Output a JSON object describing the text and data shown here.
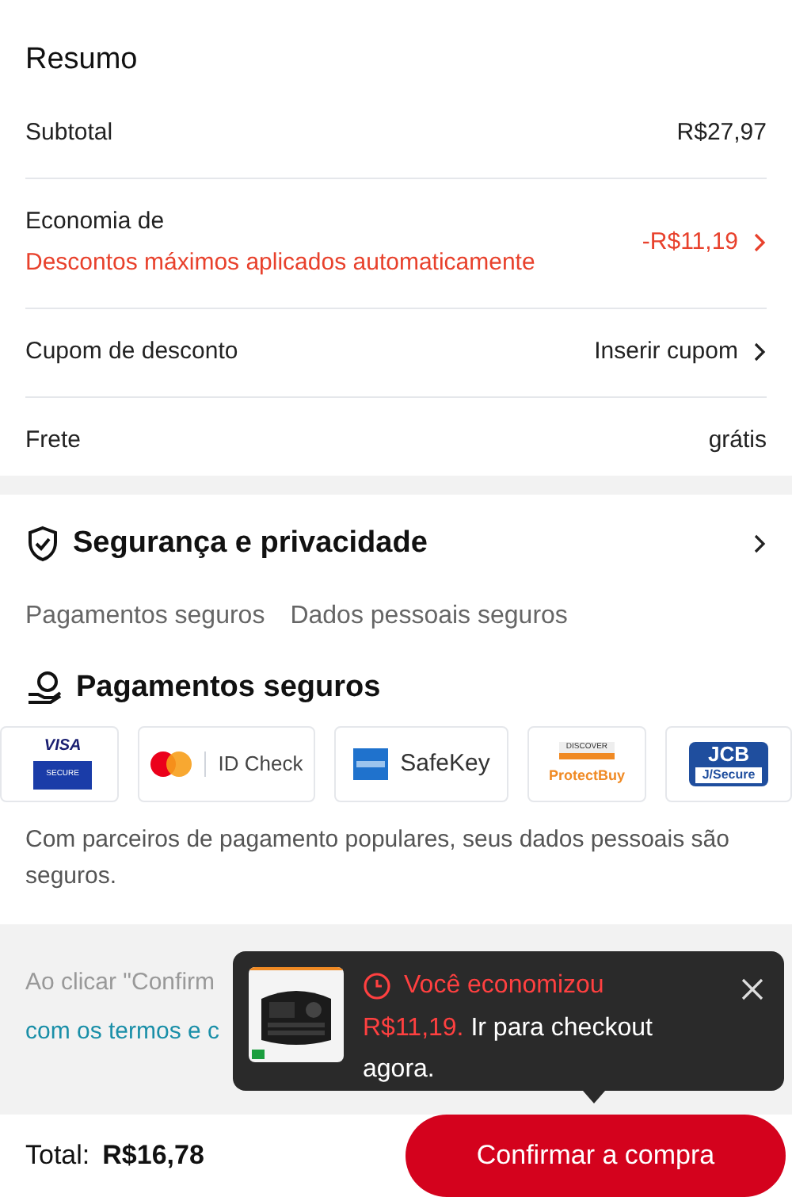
{
  "summary": {
    "title": "Resumo",
    "rows": [
      {
        "kind": "plain",
        "label": "Subtotal",
        "value": "R$27,97"
      },
      {
        "kind": "discount",
        "label": "Economia de",
        "note": "Descontos máximos aplicados automaticamente",
        "value": "-R$11,19"
      },
      {
        "kind": "link",
        "label": "Cupom de desconto",
        "value": "Inserir cupom"
      },
      {
        "kind": "plain",
        "label": "Frete",
        "value": "grátis"
      }
    ]
  },
  "security": {
    "title": "Segurança e privacidade",
    "tags": [
      "Pagamentos seguros",
      "Dados pessoais seguros"
    ],
    "payments_title": "Pagamentos seguros",
    "logos": [
      {
        "kind": "visa",
        "texts": [
          "VISA",
          "SECURE"
        ]
      },
      {
        "kind": "mastercard",
        "texts": [
          "ID Check"
        ]
      },
      {
        "kind": "amex",
        "texts": [
          "SafeKey"
        ]
      },
      {
        "kind": "discover",
        "texts": [
          "DISCOVER",
          "ProtectBuy"
        ]
      },
      {
        "kind": "jcb",
        "texts": [
          "JCB",
          "J/Secure"
        ]
      }
    ],
    "note": "Com parceiros de pagamento populares, seus dados pessoais são seguros."
  },
  "terms": {
    "line_1": "Ao clicar \"Confirm",
    "line_2": "com os termos e c"
  },
  "popup": {
    "title": "Você economizou",
    "amount": "R$11,19.",
    "message": "Ir para checkout agora."
  },
  "footer": {
    "total_label": "Total:",
    "total": "R$16,78",
    "button": "Confirmar a compra"
  }
}
